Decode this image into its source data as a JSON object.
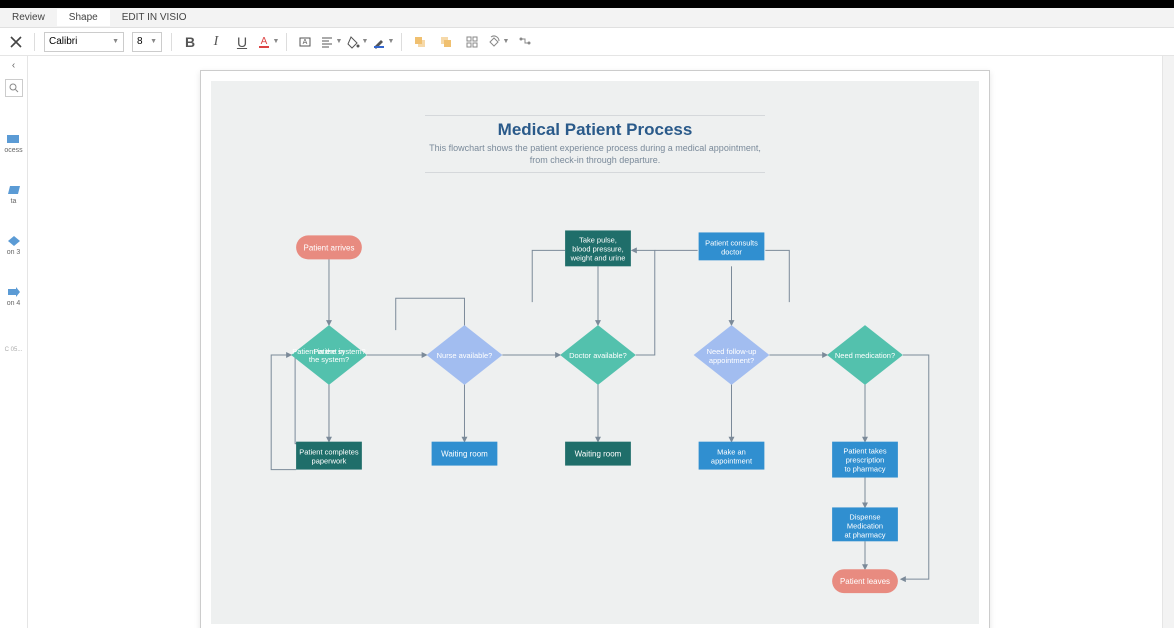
{
  "tabs": {
    "review": "Review",
    "shape": "Shape",
    "edit_in_visio": "EDIT IN VISIO"
  },
  "toolbar": {
    "font": "Calibri",
    "size": "8"
  },
  "sidebar": {
    "items": [
      "ocess",
      "ta",
      "on 3",
      "on 4",
      "C 05..."
    ]
  },
  "flowchart": {
    "title": "Medical Patient Process",
    "subtitle": "This flowchart shows the patient experience process during a medical appointment, from check-in through departure.",
    "nodes": {
      "start": "Patient arrives",
      "d1": "Patient in the system?",
      "p1a": "Patient completes paperwork",
      "d2": "Nurse available?",
      "p2a": "Waiting room",
      "p3t": "Take pulse, blood pressure, weight and urine",
      "d3": "Doctor available?",
      "p3a": "Waiting room",
      "p4t": "Patient consults doctor",
      "d4": "Need follow-up appointment?",
      "p4a": "Make an appointment",
      "d5": "Need medication?",
      "p5a": "Patient takes prescription to pharmacy",
      "p5b": "Dispense Medication at pharmacy",
      "end": "Patient leaves"
    }
  }
}
